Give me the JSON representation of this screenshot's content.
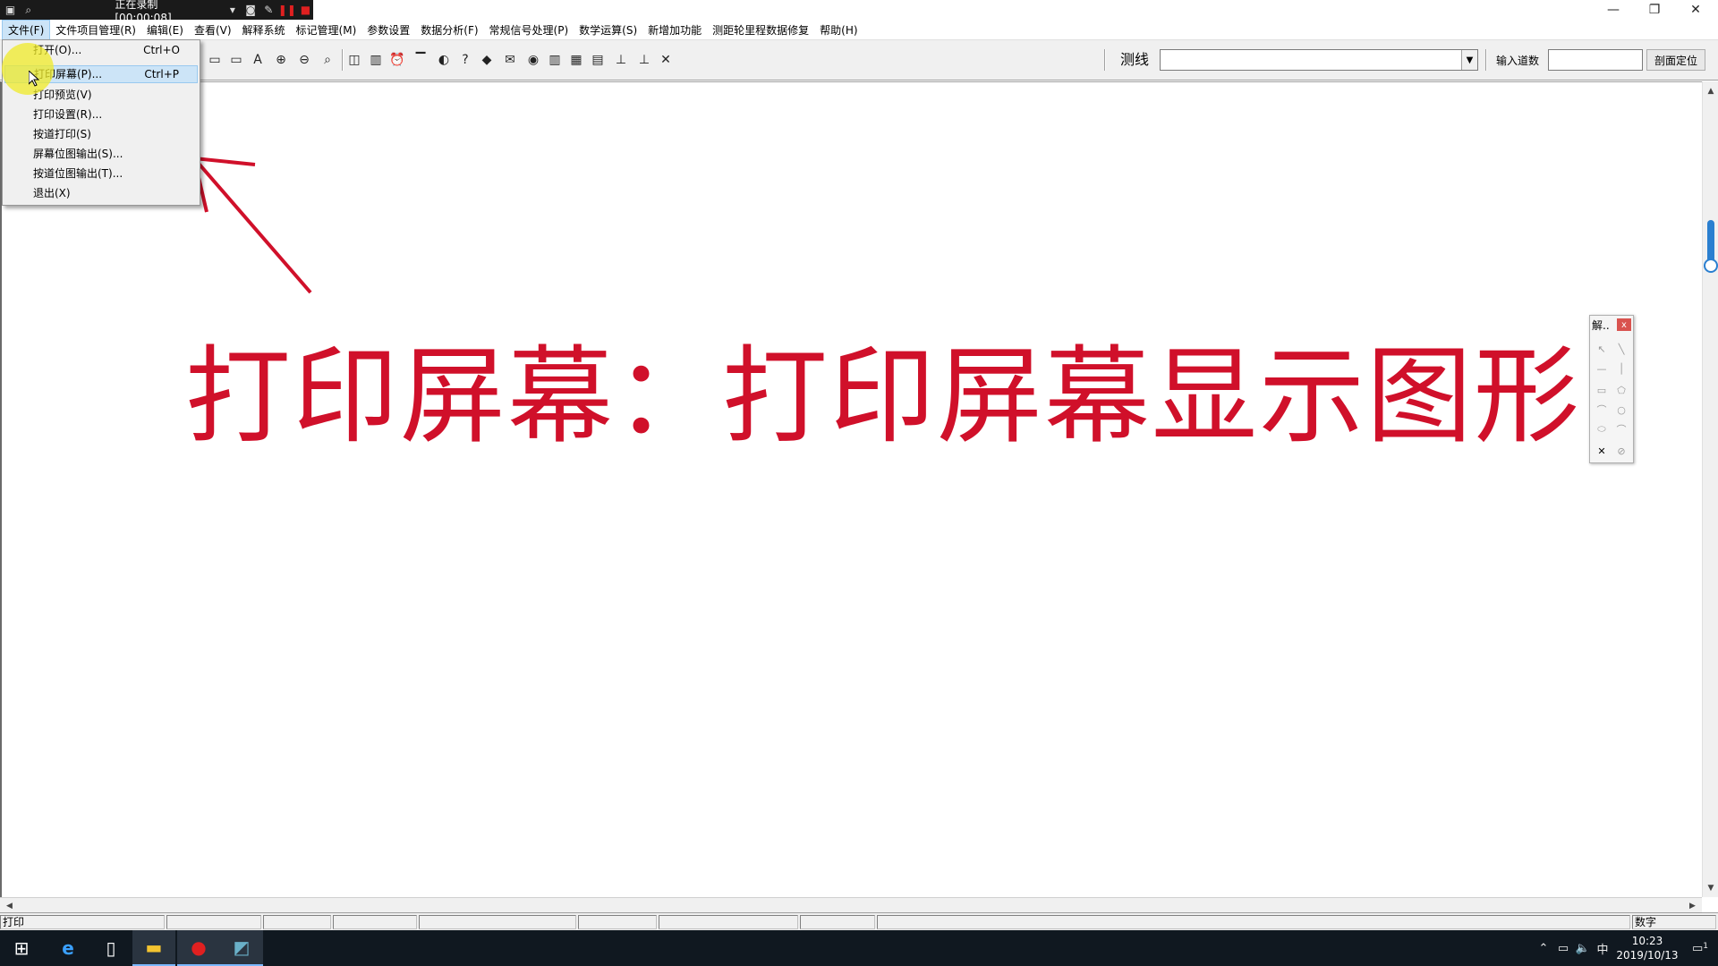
{
  "recording_bar": {
    "status": "正在录制 [00:00:08]"
  },
  "menubar": {
    "items": [
      "文件(F)",
      "文件项目管理(R)",
      "编辑(E)",
      "查看(V)",
      "解释系统",
      "标记管理(M)",
      "参数设置",
      "数据分析(F)",
      "常规信号处理(P)",
      "数学运算(S)",
      "新增加功能",
      "测距轮里程数据修复",
      "帮助(H)"
    ]
  },
  "file_menu": {
    "items": [
      {
        "label": "打开(O)...",
        "shortcut": "Ctrl+O"
      },
      {
        "label": "打印屏幕(P)...",
        "shortcut": "Ctrl+P"
      },
      {
        "label": "打印预览(V)",
        "shortcut": ""
      },
      {
        "label": "打印设置(R)...",
        "shortcut": ""
      },
      {
        "label": "按道打印(S)",
        "shortcut": ""
      },
      {
        "label": "屏幕位图输出(S)...",
        "shortcut": ""
      },
      {
        "label": "按道位图输出(T)...",
        "shortcut": ""
      },
      {
        "label": "退出(X)",
        "shortcut": ""
      }
    ]
  },
  "toolbar": {
    "survey_label": "测线",
    "survey_value": "",
    "trace_label": "输入道数",
    "trace_value": "",
    "profile_button": "剖面定位"
  },
  "annotation": {
    "text": "打印屏幕：打印屏幕显示图形"
  },
  "draw_panel": {
    "title": "解..",
    "close": "x"
  },
  "statusbar": {
    "left": "打印",
    "right": "数字"
  },
  "taskbar": {
    "time": "10:23",
    "date": "2019/10/13",
    "ime": "中",
    "notifications": "1"
  },
  "colors": {
    "annotation": "#d0102a",
    "highlight": "#cce4f7",
    "cursor_halo": "#f0eb28"
  },
  "icons": [
    "windows-start-icon",
    "edge-icon",
    "file-icon",
    "explorer-icon",
    "record-icon",
    "app-icon"
  ]
}
